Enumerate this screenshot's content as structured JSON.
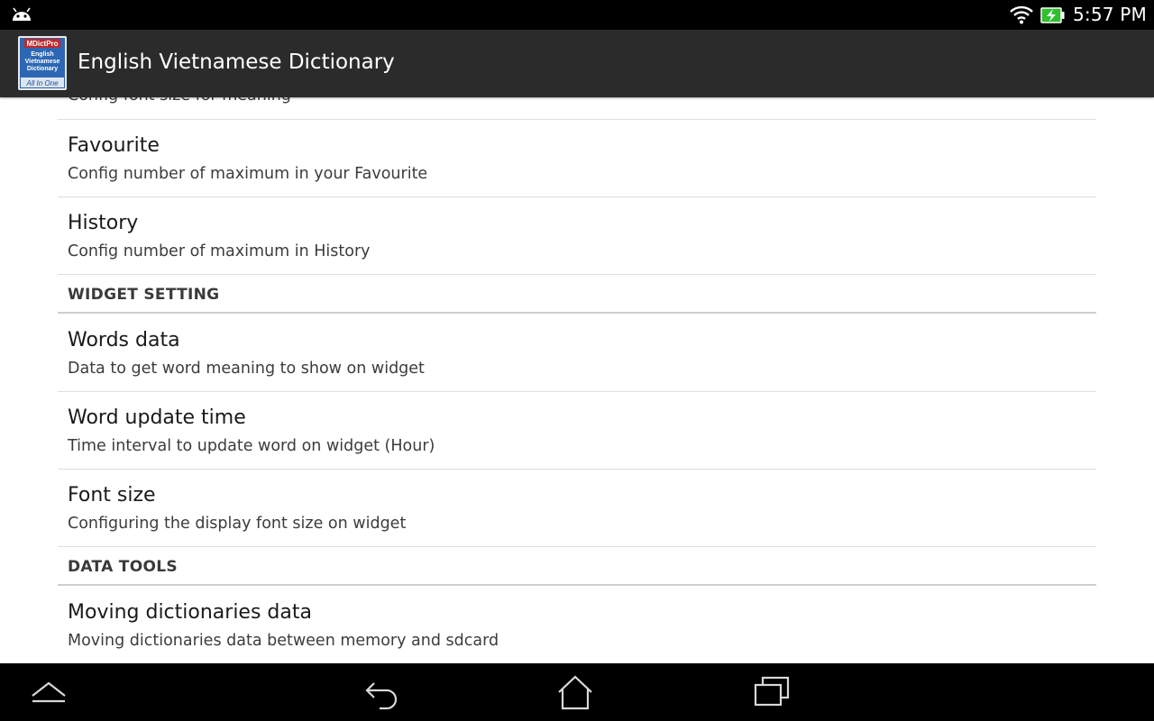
{
  "status_bar": {
    "time": "5:57 PM",
    "icons": [
      "android-debug-icon",
      "wifi-icon",
      "battery-charging-icon"
    ]
  },
  "action_bar": {
    "title": "English Vietnamese Dictionary",
    "logo": {
      "top_text": "MDictPro",
      "line1": "English",
      "line2": "Vietnamese",
      "line3": "Dictionary",
      "bottom_text": "All In One"
    }
  },
  "preferences": {
    "cut_off_summary": "Config font size for meaning",
    "favourite": {
      "title": "Favourite",
      "summary": "Config number of maximum in your Favourite"
    },
    "history": {
      "title": "History",
      "summary": "Config number of maximum in History"
    },
    "widget_section": "WIDGET SETTING",
    "words_data": {
      "title": "Words data",
      "summary": "Data to get word meaning to show on widget"
    },
    "word_update_time": {
      "title": "Word update time",
      "summary": "Time interval to update word on widget (Hour)"
    },
    "font_size": {
      "title": "Font size",
      "summary": "Configuring the display font size on widget"
    },
    "data_tools_section": "DATA TOOLS",
    "moving_data": {
      "title": "Moving dictionaries data",
      "summary": "Moving dictionaries data between memory and sdcard"
    }
  },
  "nav_bar": {
    "icons": [
      "up-chevron-icon",
      "back-icon",
      "home-icon",
      "recent-apps-icon"
    ]
  },
  "colors": {
    "status_bar": "#000000",
    "action_bar": "#2b2b2b",
    "divider": "#dedede",
    "section_divider": "#cfcfcf"
  }
}
